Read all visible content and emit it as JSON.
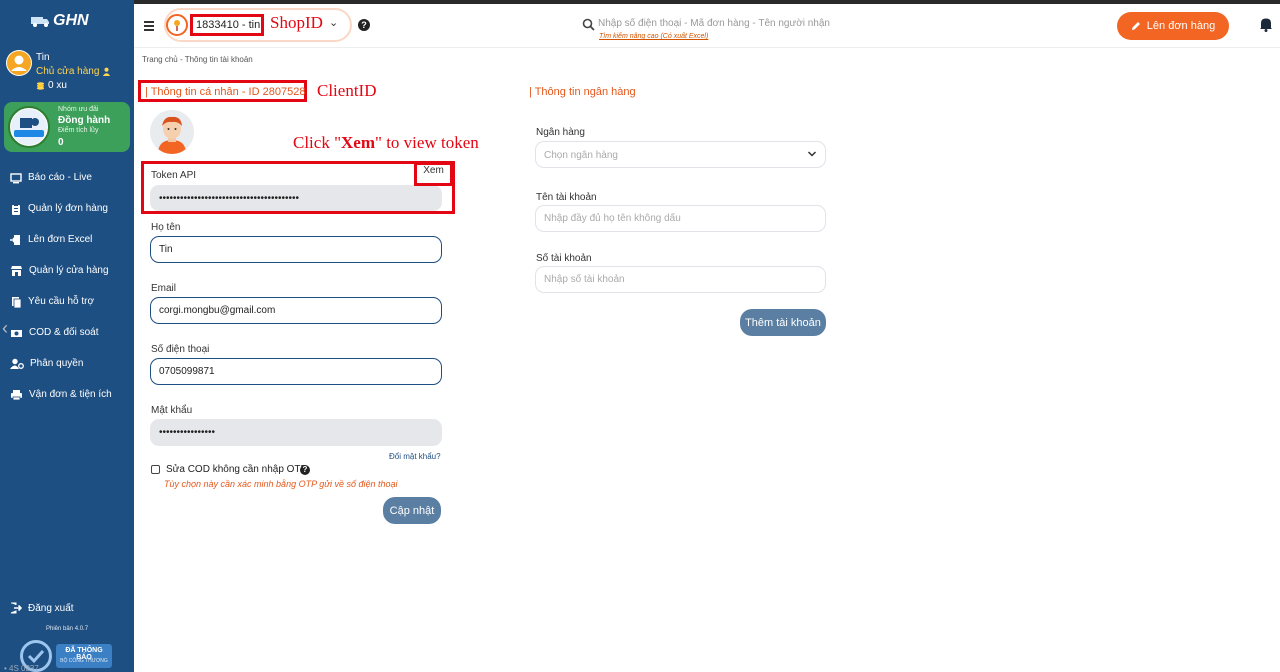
{
  "brand": {
    "logo_text": "GHN"
  },
  "user": {
    "name": "Tin",
    "role": "Chủ cửa hàng",
    "coins": "0 xu"
  },
  "tier": {
    "subtitle": "Nhóm ưu đãi",
    "name": "Đồng hành",
    "points_label": "Điểm tích lũy",
    "points": "0"
  },
  "nav": {
    "items": [
      {
        "label": "Báo cáo - Live",
        "icon": "monitor-icon"
      },
      {
        "label": "Quản lý đơn hàng",
        "icon": "clipboard-icon"
      },
      {
        "label": "Lên đơn Excel",
        "icon": "file-import-icon"
      },
      {
        "label": "Quản lý cửa hàng",
        "icon": "store-icon"
      },
      {
        "label": "Yêu cầu hỗ trợ",
        "icon": "support-ticket-icon"
      },
      {
        "label": "COD & đối soát",
        "icon": "money-icon"
      },
      {
        "label": "Phân quyền",
        "icon": "user-gear-icon"
      },
      {
        "label": "Vận đơn & tiện ích",
        "icon": "printer-icon"
      }
    ],
    "logout": "Đăng xuất",
    "version": "Phiên bản 4.0.7"
  },
  "certification": {
    "line1": "ĐÃ THÔNG BÁO",
    "line2": "BỘ CÔNG THƯƠNG"
  },
  "sidebar_faded_text": "• 4S 0337",
  "header": {
    "shop_id": "1833410 - tin",
    "shop_annotation": "ShopID",
    "search_placeholder": "Nhập số điện thoại - Mã đơn hàng - Tên người nhận",
    "advanced_search": "Tìm kiếm nâng cao (Có xuất Excel)",
    "create_order": "Lên đơn hàng"
  },
  "breadcrumb": "Trang chủ - Thông tin tài khoản",
  "personal": {
    "title": "| Thông tin cá nhân - ID 2807528",
    "client_annotation": "ClientID",
    "token_annotation_pre": "Click \"",
    "token_annotation_bold": "Xem",
    "token_annotation_post": "\" to view token",
    "token_label": "Token API",
    "token_view": "Xem",
    "token_value": "••••••••••••••••••••••••••••••••••••••••",
    "name_label": "Họ tên",
    "name_value": "Tin",
    "email_label": "Email",
    "email_value": "corgi.mongbu@gmail.com",
    "phone_label": "Số điện thoại",
    "phone_value": "0705099871",
    "password_label": "Mật khẩu",
    "password_value": "••••••••••••••••",
    "forgot_password": "Đổi mật khẩu?",
    "cod_otp_label": "Sửa COD không cần nhập OTP",
    "cod_otp_note": "Tùy chọn này cần xác minh bằng OTP gửi về số điện thoại",
    "update_button": "Cập nhật"
  },
  "bank": {
    "title": "| Thông tin ngân hàng",
    "bank_label": "Ngân hàng",
    "bank_placeholder": "Chọn ngân hàng",
    "account_name_label": "Tên tài khoản",
    "account_name_placeholder": "Nhập đầy đủ họ tên không dấu",
    "account_number_label": "Số tài khoản",
    "account_number_placeholder": "Nhập số tài khoản",
    "add_button": "Thêm tài khoản"
  },
  "colors": {
    "sidebar": "#1e4f82",
    "accent": "#f26522",
    "annotation": "#e30613",
    "tier": "#3c9f5a"
  }
}
